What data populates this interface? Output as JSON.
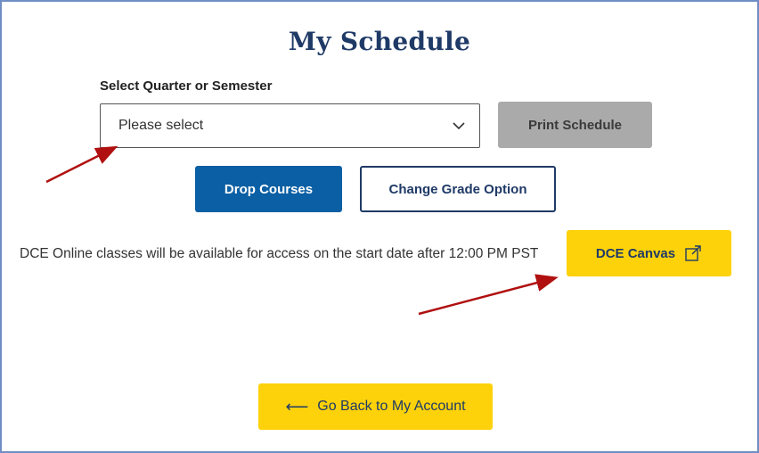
{
  "page": {
    "title": "My Schedule"
  },
  "term_select": {
    "label": "Select Quarter or Semester",
    "value": "Please select"
  },
  "buttons": {
    "print": "Print Schedule",
    "drop": "Drop Courses",
    "change_grade": "Change Grade Option",
    "canvas": "DCE Canvas",
    "back": "Go Back to My Account"
  },
  "notice": {
    "text": "DCE Online classes will be available for access on the start date after 12:00 PM PST"
  },
  "icons": {
    "select_chevron": "chevron-down-icon",
    "canvas_external": "external-link-icon",
    "back_arrow": "arrow-left-icon"
  },
  "colors": {
    "title": "#1f3a66",
    "primary_blue": "#0b5fa4",
    "accent_yellow": "#fdd20b",
    "disabled_gray": "#aaaaaa",
    "annotation_red": "#b01010"
  }
}
